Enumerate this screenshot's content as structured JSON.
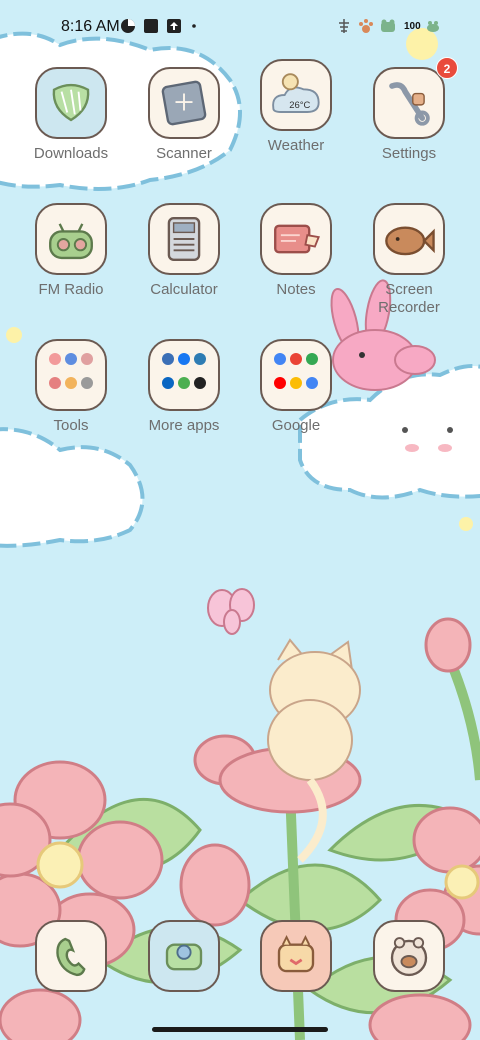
{
  "status_bar": {
    "time": "8:16 AM",
    "battery": "100",
    "left_icons": [
      "signal-app-icon",
      "stop-square-icon",
      "upload-icon",
      "dot-icon"
    ],
    "right_icons": [
      "fish-bone-icon",
      "paw-icon",
      "frog-icon",
      "battery-icon"
    ]
  },
  "apps": [
    {
      "label": "Downloads",
      "icon": "downloads-icon"
    },
    {
      "label": "Scanner",
      "icon": "scanner-icon"
    },
    {
      "label": "Weather",
      "icon": "weather-icon",
      "temp": "26°C"
    },
    {
      "label": "Settings",
      "icon": "settings-icon",
      "badge": "2"
    },
    {
      "label": "FM Radio",
      "icon": "fm-radio-icon"
    },
    {
      "label": "Calculator",
      "icon": "calculator-icon"
    },
    {
      "label": "Notes",
      "icon": "notes-icon"
    },
    {
      "label": "Screen Recorder",
      "icon": "screen-recorder-icon"
    },
    {
      "label": "Tools",
      "icon": "tools-folder-icon"
    },
    {
      "label": "More apps",
      "icon": "more-apps-folder-icon"
    },
    {
      "label": "Google",
      "icon": "google-folder-icon"
    }
  ],
  "dock": [
    {
      "icon": "phone-icon"
    },
    {
      "icon": "messages-icon"
    },
    {
      "icon": "camera-icon"
    },
    {
      "icon": "chrome-icon"
    }
  ],
  "colors": {
    "sky": "#cdeef8",
    "tile_bg": "#fbf4ea",
    "tile_border": "#6b5a52",
    "label": "#6e6e6e",
    "badge": "#e94b3c",
    "flower": "#f4b4b8",
    "leaf": "#b9dfa0"
  }
}
